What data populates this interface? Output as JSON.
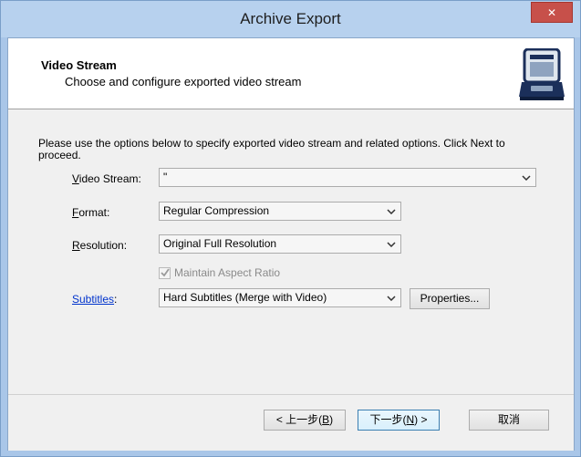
{
  "window": {
    "title": "Archive Export",
    "close_glyph": "✕"
  },
  "header": {
    "title": "Video Stream",
    "subtitle": "Choose and configure exported video stream",
    "icon": "archive-device-icon"
  },
  "body": {
    "intro": "Please use the options below to specify exported video stream and related options. Click Next to proceed.",
    "video_stream": {
      "label_first": "V",
      "label_rest": "ideo Stream:",
      "value": "\""
    },
    "format": {
      "label_first": "F",
      "label_rest": "ormat:",
      "value": "Regular Compression"
    },
    "resolution": {
      "label_first": "R",
      "label_rest": "esolution:",
      "value": "Original Full Resolution"
    },
    "aspect": {
      "label": "Maintain Aspect Ratio",
      "checked": true
    },
    "subtitles": {
      "label": "Subtitles",
      "colon": ":",
      "value": "Hard Subtitles (Merge with Video)",
      "properties_label": "Properties..."
    }
  },
  "footer": {
    "back_label": "< 上一步(",
    "back_mn": "B",
    "back_end": ")",
    "next_label": "下一步(",
    "next_mn": "N",
    "next_end": ") >",
    "cancel_label": "取消"
  },
  "colors": {
    "titlebar": "#b7d1ee",
    "close": "#c7504a",
    "link": "#0033cc"
  }
}
